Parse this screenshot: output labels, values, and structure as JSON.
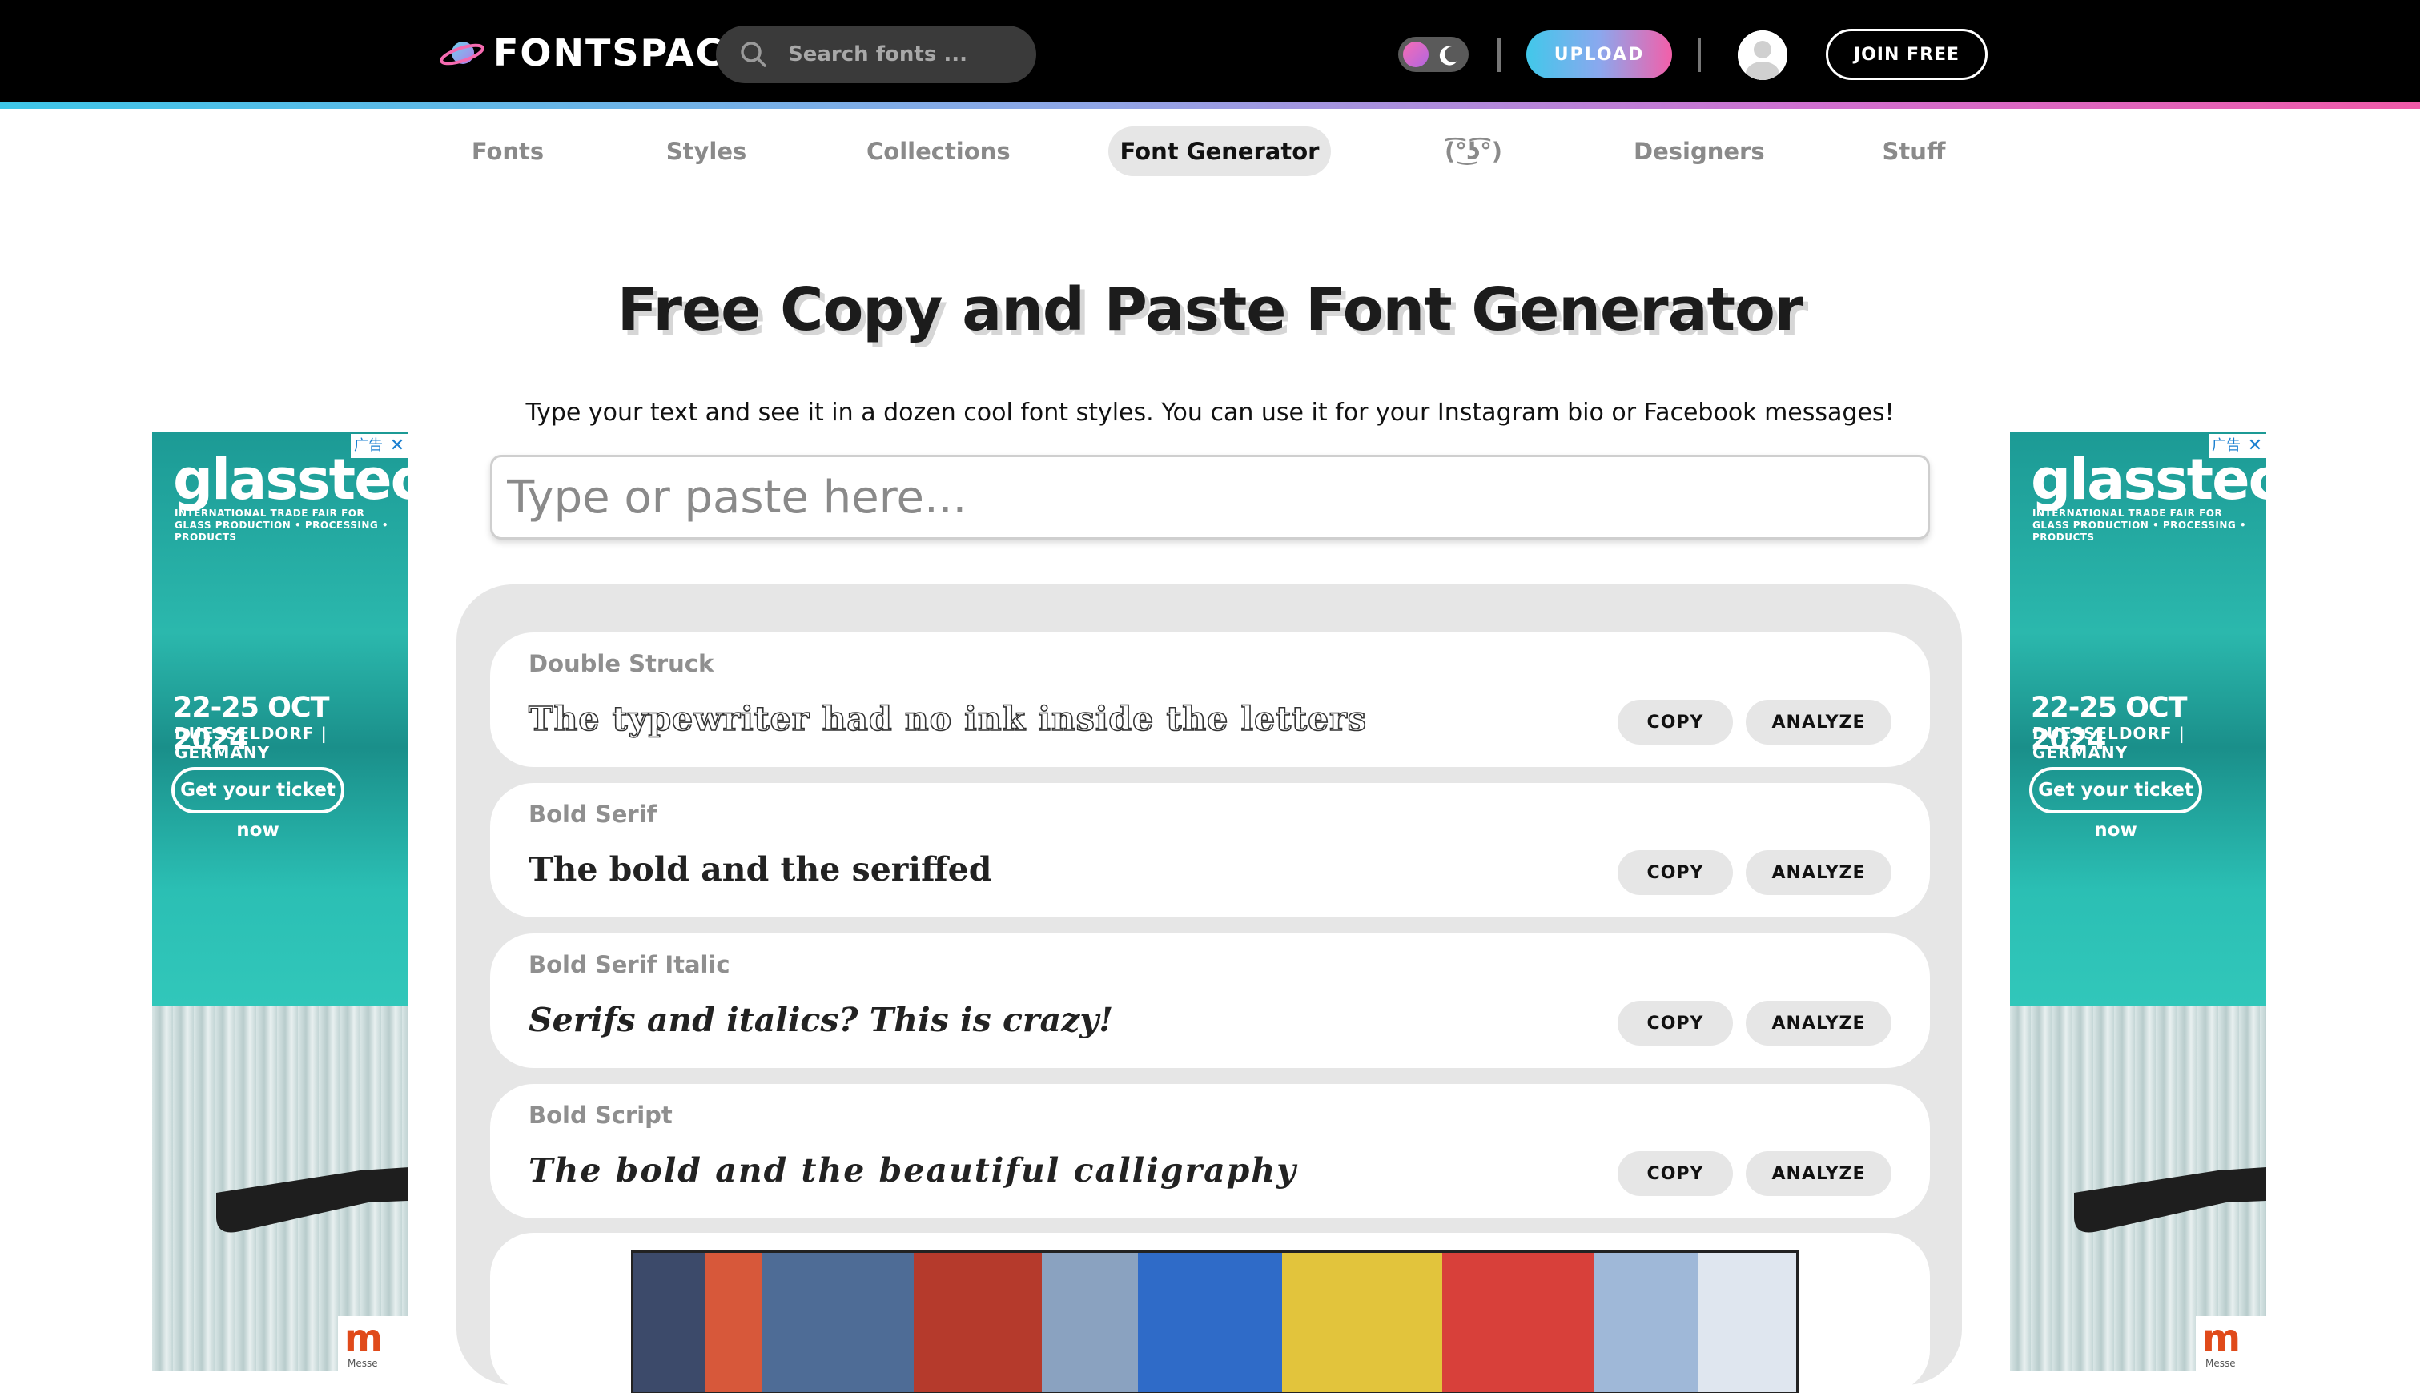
{
  "header": {
    "logo_text": "FONTSPACE",
    "search_placeholder": "Search fonts ...",
    "upload_label": "UPLOAD",
    "join_label": "JOIN FREE"
  },
  "nav": {
    "items": [
      {
        "label": "Fonts",
        "active": false
      },
      {
        "label": "Styles",
        "active": false
      },
      {
        "label": "Collections",
        "active": false
      },
      {
        "label": "Font Generator",
        "active": true
      },
      {
        "label": "(͡°͜ʖ͡°)",
        "active": false
      },
      {
        "label": "Designers",
        "active": false
      },
      {
        "label": "Stuff",
        "active": false
      }
    ]
  },
  "main": {
    "title": "Free Copy and Paste Font Generator",
    "subtitle": "Type your text and see it in a dozen cool font styles. You can use it for your Instagram bio or Facebook messages!",
    "input_placeholder": "Type or paste here..."
  },
  "generators": [
    {
      "name": "Double Struck",
      "sample": "The typewriter had no ink inside the letters",
      "style": "outline"
    },
    {
      "name": "Bold Serif",
      "sample": "The bold and the seriffed",
      "style": "bold"
    },
    {
      "name": "Bold Serif Italic",
      "sample": "Serifs and italics? This is crazy!",
      "style": "bolditalic"
    },
    {
      "name": "Bold Script",
      "sample": "The bold and the beautiful calligraphy",
      "style": "script"
    }
  ],
  "buttons": {
    "copy_label": "COPY",
    "analyze_label": "ANALYZE"
  },
  "ad": {
    "brand": "glasstec",
    "tagline": "INTERNATIONAL TRADE FAIR FOR GLASS PRODUCTION • PROCESSING • PRODUCTS",
    "dates": "22-25 OCT 2024",
    "location": "DUESSELDORF | GERMANY",
    "cta": "Get your ticket now",
    "badge": "广告",
    "close_glyph": "✕",
    "messe_mark": "m",
    "messe_text": "Messe"
  },
  "colors": {
    "accent_gradient_start": "#41c8ea",
    "accent_gradient_end": "#f35fa9",
    "ad_teal": "#1fa39c"
  }
}
